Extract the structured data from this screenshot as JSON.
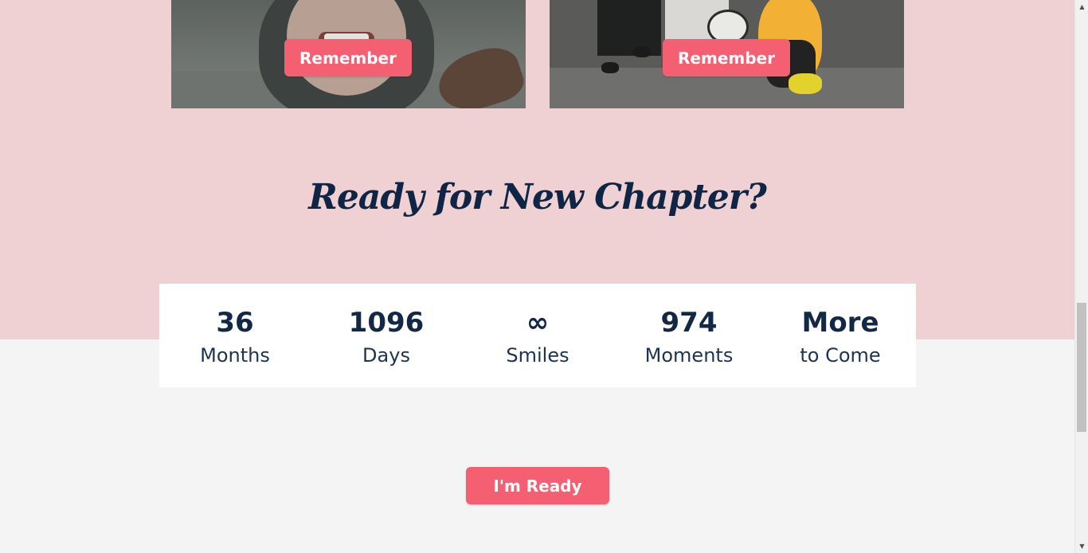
{
  "gallery": {
    "cards": [
      {
        "button_label": "Remember",
        "photo": "girl-in-hijab-laughing"
      },
      {
        "button_label": "Remember",
        "photo": "graduation-owl-balloon"
      }
    ]
  },
  "headline": "Ready for New Chapter?",
  "stats": [
    {
      "value": "36",
      "label": "Months"
    },
    {
      "value": "1096",
      "label": "Days"
    },
    {
      "value": "∞",
      "label": "Smiles"
    },
    {
      "value": "974",
      "label": "Moments"
    },
    {
      "value": "More",
      "label": "to Come"
    }
  ],
  "cta": {
    "label": "I'm Ready"
  },
  "colors": {
    "pink_band": "#f0d1d3",
    "accent": "#f45f72",
    "navy_text": "#0f2545",
    "page_bg": "#f4f4f4"
  },
  "icons": {
    "scroll_up": "chevron-up-icon",
    "scroll_down": "chevron-down-icon"
  }
}
